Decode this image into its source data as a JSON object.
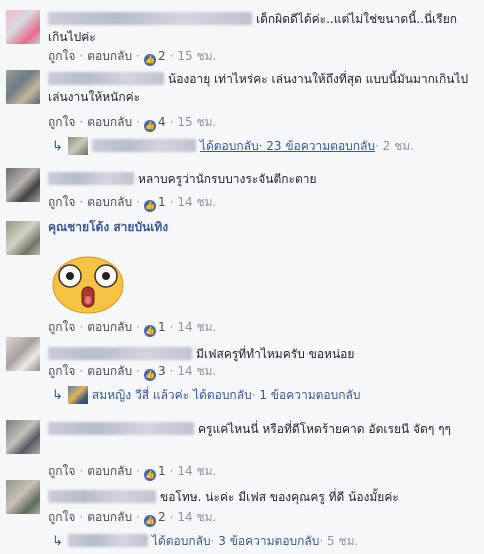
{
  "labels": {
    "like": "ถูกใจ",
    "reply": "ตอบกลับ",
    "sep": "·"
  },
  "comments": [
    {
      "text": "เด็กผิดดีได้ค่ะ..แต่ไม่ใช่ขนาดนี้..นี่เรียกเกินไปค่ะ",
      "likes": "2",
      "time": "15 ชม."
    },
    {
      "text": "น้องอายุ เท่าไหร่คะ เล่นงานให้ถึงที่สุด แบบนี้มันมากเกินไป เล่นงานให้หนักค่ะ",
      "likes": "4",
      "time": "15 ชม.",
      "reply_summary": {
        "label": "ได้ตอบกลับ",
        "count": "23 ข้อความตอบกลับ",
        "time": "2 ชม."
      }
    },
    {
      "text": "หลาบครูว่านักรบบางระจันตีกะตาย",
      "likes": "1",
      "time": "14 ชม."
    },
    {
      "name": "คุณชายโด้ง สายบันเทิง",
      "likes": "1",
      "time": "14 ชม."
    },
    {
      "text": "มีเฟสครูที่ทำไหมครับ ขอหน่อย",
      "likes": "3",
      "time": "14 ชม.",
      "reply_summary": {
        "name": "สมหญิง วีสี่",
        "label": "แล้วค่ะ",
        "label2": "ได้ตอบกลับ",
        "count": "1 ข้อความตอบกลับ"
      }
    },
    {
      "text": "ครูแค่ไหนนี่ หรือที่ดีโหดร้ายคาด อัดเรยนี จัดๆ ๆๆ",
      "likes": "1",
      "time": "14 ชม."
    },
    {
      "text": "ขอโทษ. น่ะค่ะ มีเฟส ของคุณครู ที่ดี น้องมั้ยค่ะ",
      "likes": "2",
      "time": "14 ชม.",
      "reply_summary": {
        "label": "ได้ตอบกลับ",
        "count": "3 ข้อความตอบกลับ",
        "time": "5 ชม."
      }
    }
  ],
  "icons": {
    "reply_arrow": "reply-arrow-icon",
    "like": "thumbs-up-icon",
    "sticker": "shocked-face-sticker"
  },
  "colors": {
    "link": "#385898",
    "like_badge": "#4267b2",
    "meta": "#90949c",
    "background": "#f6f7f9"
  }
}
